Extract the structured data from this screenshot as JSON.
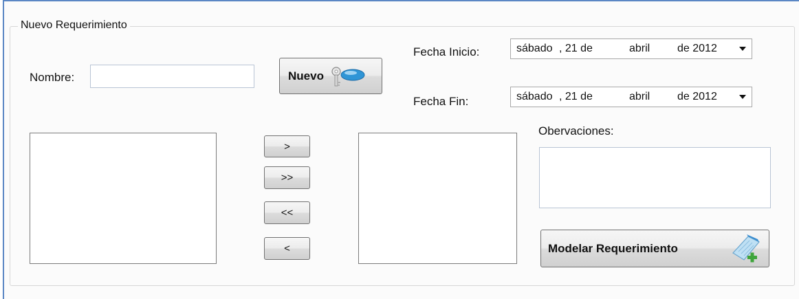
{
  "group": {
    "title": "Nuevo Requerimiento"
  },
  "nombre": {
    "label": "Nombre:",
    "value": ""
  },
  "nuevo_button": {
    "label": "Nuevo",
    "icon": "key-icon"
  },
  "fecha_inicio": {
    "label": "Fecha Inicio:",
    "day_name": "sábado",
    "day": ", 21 de",
    "month": "abril",
    "year": "de 2012"
  },
  "fecha_fin": {
    "label": "Fecha Fin:",
    "day_name": "sábado",
    "day": ", 21 de",
    "month": "abril",
    "year": "de 2012"
  },
  "move_buttons": {
    "add_one": ">",
    "add_all": ">>",
    "remove_all": "<<",
    "remove_one": "<"
  },
  "observaciones": {
    "label": "Obervaciones:",
    "value": ""
  },
  "modelar_button": {
    "label": "Modelar Requerimiento",
    "icon": "notepad-add-icon"
  }
}
